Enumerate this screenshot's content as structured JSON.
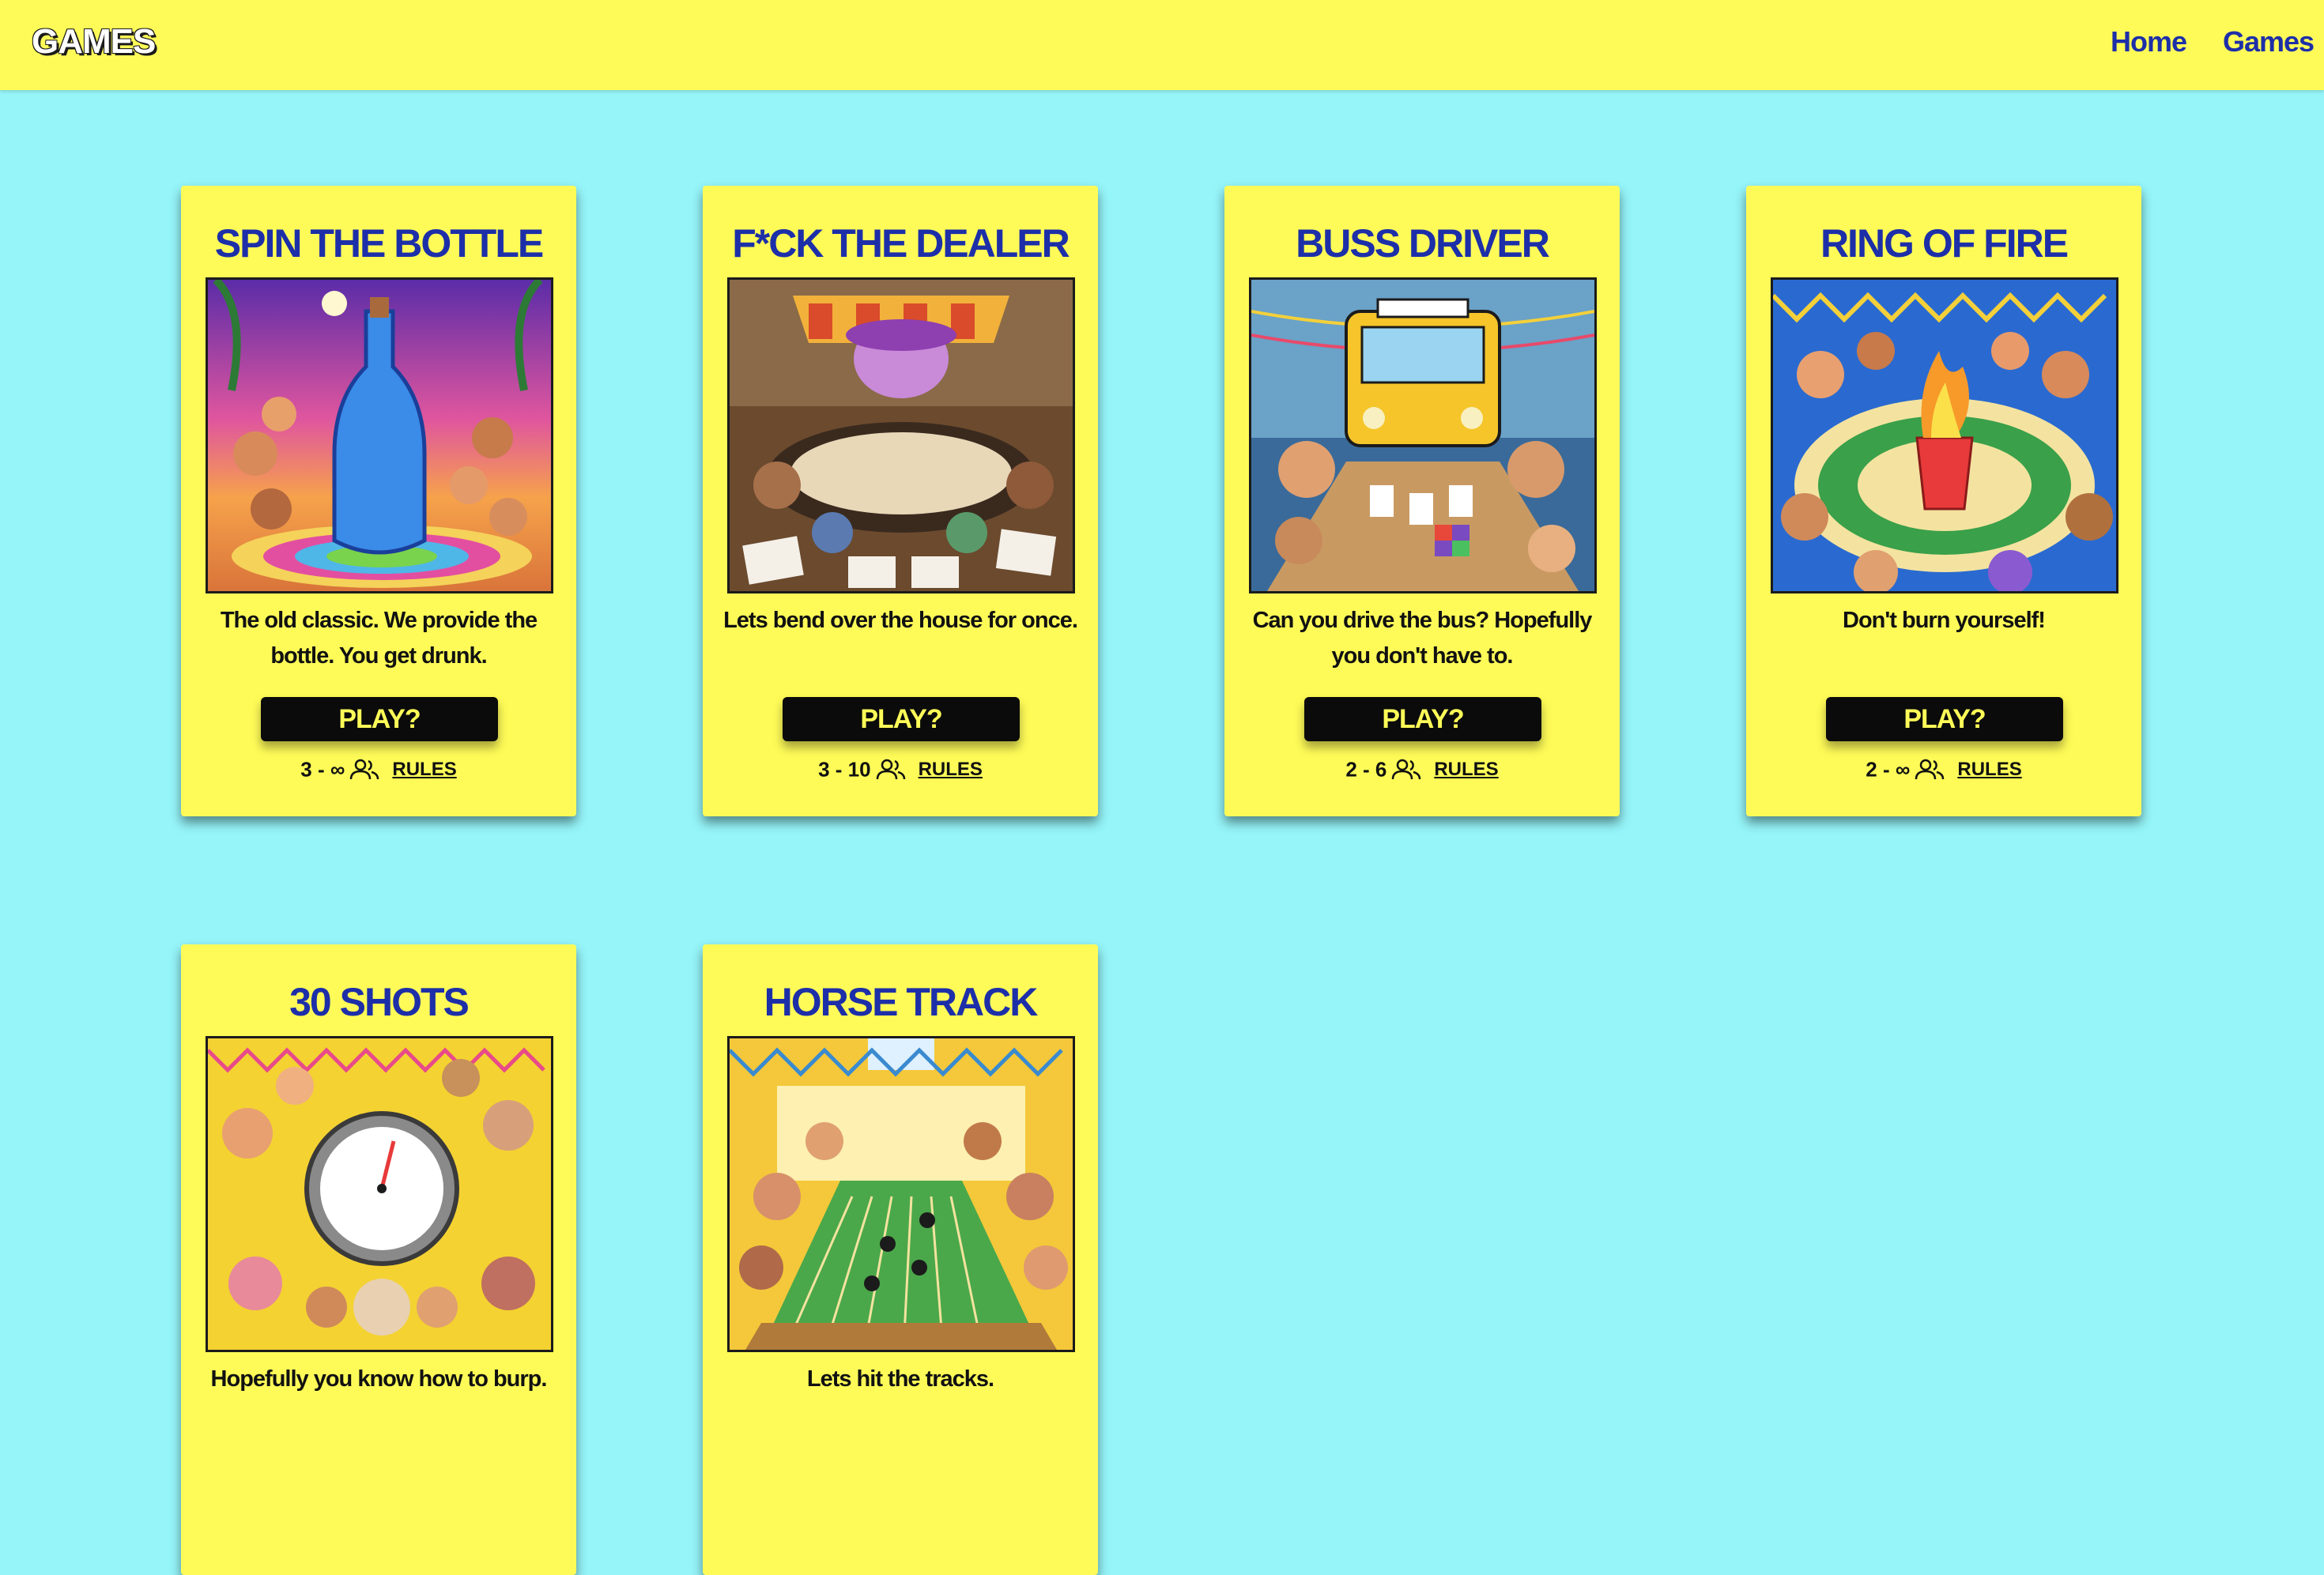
{
  "navbar": {
    "brand": "GAMES",
    "links": [
      "Home",
      "Games"
    ]
  },
  "colors": {
    "page_bg": "#95f5f9",
    "navbar_bg": "#fefb58",
    "card_bg": "#fefb58",
    "title": "#1d2fa8",
    "button_bg": "#0b0b0b",
    "button_text": "#fefb58"
  },
  "games": [
    {
      "title": "SPIN THE BOTTLE",
      "description": "The old classic. We provide the bottle. You get drunk.",
      "play": "PLAY?",
      "players": "3 - ∞",
      "rules": "RULES",
      "icon": "users-icon"
    },
    {
      "title": "F*CK THE DEALER",
      "description": "Lets bend over the house for once.",
      "play": "PLAY?",
      "players": "3 - 10",
      "rules": "RULES",
      "icon": "users-icon"
    },
    {
      "title": "BUSS DRIVER",
      "description": "Can you drive the bus? Hopefully you don't have to.",
      "play": "PLAY?",
      "players": "2 - 6",
      "rules": "RULES",
      "icon": "users-icon"
    },
    {
      "title": "RING OF FIRE",
      "description": "Don't burn yourself!",
      "play": "PLAY?",
      "players": "2 - ∞",
      "rules": "RULES",
      "icon": "users-icon"
    },
    {
      "title": "30 SHOTS",
      "description": "Hopefully you know how to burp."
    },
    {
      "title": "HORSE TRACK",
      "description": "Lets hit the tracks."
    }
  ]
}
